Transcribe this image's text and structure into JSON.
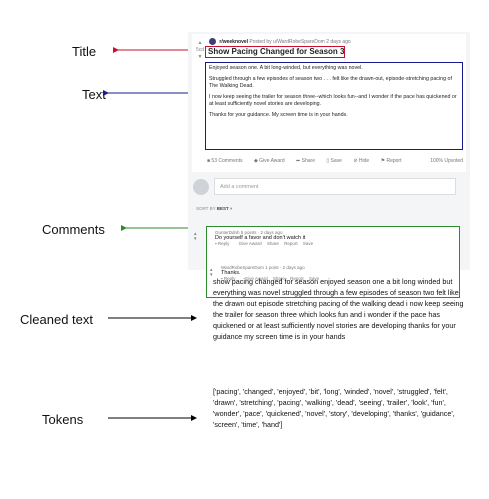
{
  "labels": {
    "title": "Title",
    "text": "Text",
    "comments": "Comments",
    "cleaned_text": "Cleaned text",
    "tokens": "Tokens"
  },
  "colors": {
    "title_arrow": "#c8102e",
    "text_arrow": "#1a1a8c",
    "comments_arrow": "#2e8b2e",
    "pipeline_arrow": "#000000"
  },
  "post": {
    "vote_count": "5cd",
    "subreddit": "r/weeknovel",
    "posted_by": "Posted by u/WardRobeSpareDom 2 days ago",
    "title": "Show Pacing Changed for Season 3?",
    "paragraphs": [
      "Enjoyed season one. A bit long-winded, but everything was novel.",
      "Struggled through a few episodes of season two . . . felt like the drawn-out, episode-stretching pacing of The Walking Dead.",
      "I now keep seeing the trailer for season three--which looks fun--and I wonder if the pace has quickened or at least sufficiently novel stories are developing.",
      "Thanks for your guidance. My screen time is in your hands."
    ],
    "actions": [
      "53 Comments",
      "Give Award",
      "Share",
      "Save",
      "Hide",
      "Report"
    ],
    "upvoted": "100% Upvoted",
    "add_comment_placeholder": "Add a comment",
    "sort_label": "SORT BY",
    "sort_value": "BEST"
  },
  "comments": [
    {
      "user": "GunterDdnh",
      "meta": "5 points · 2 days ago",
      "body": "Do yourself a favor and don't watch it",
      "actions": [
        "Reply",
        "Give Award",
        "Share",
        "Report",
        "Save"
      ]
    },
    {
      "user": "WardRobeSpareDom",
      "meta": "1 point · 2 days ago",
      "body": "Thanks.",
      "actions": [
        "Reply",
        "Give Award",
        "Share",
        "Report",
        "Save"
      ]
    }
  ],
  "cleaned_text": "show pacing changed for season enjoyed season one a bit long winded but everything was novel struggled through a few episodes of season two felt like the drawn out episode stretching pacing of the walking dead i now keep seeing the trailer for season three which looks fun and i wonder if the pace has quickened or at least sufficiently novel stories are developing thanks for your guidance my screen time is in your hands",
  "tokens": "['pacing', 'changed', 'enjoyed', 'bit', 'long', 'winded', 'novel', 'struggled', 'felt', 'drawn', 'stretching', 'pacing', 'walking', 'dead', 'seeing', 'trailer', 'look', 'fun', 'wonder', 'pace', 'quickened', 'novel', 'story', 'developing', 'thanks', 'guidance', 'screen', 'time', 'hand']"
}
